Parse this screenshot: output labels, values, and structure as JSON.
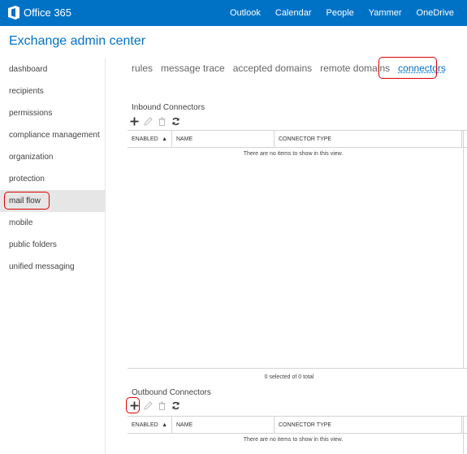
{
  "brand": {
    "name": "Office 365",
    "logo_icon": "office-logo-icon"
  },
  "topnav": [
    "Outlook",
    "Calendar",
    "People",
    "Yammer",
    "OneDrive"
  ],
  "app_title": "Exchange admin center",
  "leftnav": {
    "items": [
      "dashboard",
      "recipients",
      "permissions",
      "compliance management",
      "organization",
      "protection",
      "mail flow",
      "mobile",
      "public folders",
      "unified messaging"
    ],
    "active": "mail flow"
  },
  "subtabs": {
    "items": [
      "rules",
      "message trace",
      "accepted domains",
      "remote domains",
      "connectors"
    ],
    "active": "connectors"
  },
  "inbound": {
    "title": "Inbound Connectors",
    "toolbar": [
      "add-icon",
      "edit-icon",
      "delete-icon",
      "refresh-icon"
    ],
    "columns": [
      "ENABLED",
      "NAME",
      "CONNECTOR TYPE"
    ],
    "sort_indicator": "▲",
    "empty_message": "There are no items to show in this view.",
    "footer": "0 selected of 0 total"
  },
  "outbound": {
    "title": "Outbound Connectors",
    "toolbar": [
      "add-icon",
      "edit-icon",
      "delete-icon",
      "refresh-icon"
    ],
    "columns": [
      "ENABLED",
      "NAME",
      "CONNECTOR TYPE"
    ],
    "sort_indicator": "▲",
    "empty_message": "There are no items to show in this view."
  },
  "colors": {
    "brand_blue": "#0072c6",
    "highlight_red": "#dd0000",
    "active_nav_bg": "#e6e6e6"
  }
}
